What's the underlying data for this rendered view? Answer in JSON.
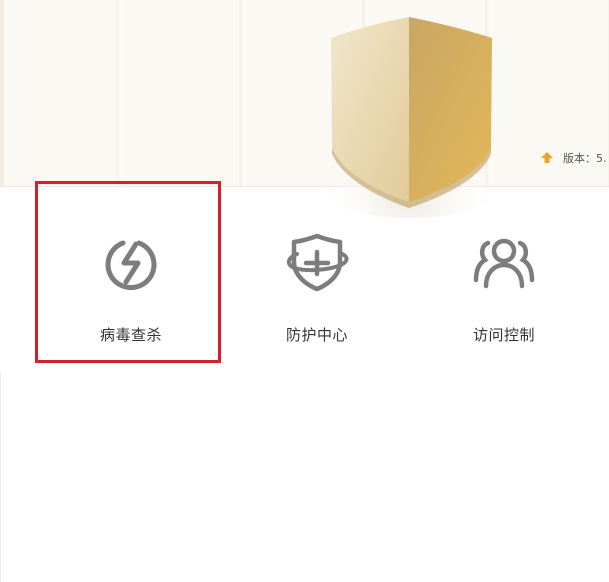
{
  "version": {
    "label": "版本：5."
  },
  "features": [
    {
      "label": "病毒查杀",
      "icon": "lightning-circle-icon"
    },
    {
      "label": "防护中心",
      "icon": "shield-plus-icon"
    },
    {
      "label": "访问控制",
      "icon": "users-icon"
    }
  ],
  "colors": {
    "shield_light": "#ecdcb9",
    "shield_dark": "#caa362",
    "highlight_border": "#d3202a",
    "icon_gray": "#7d7d7d",
    "upgrade_orange": "#f2a22a"
  }
}
